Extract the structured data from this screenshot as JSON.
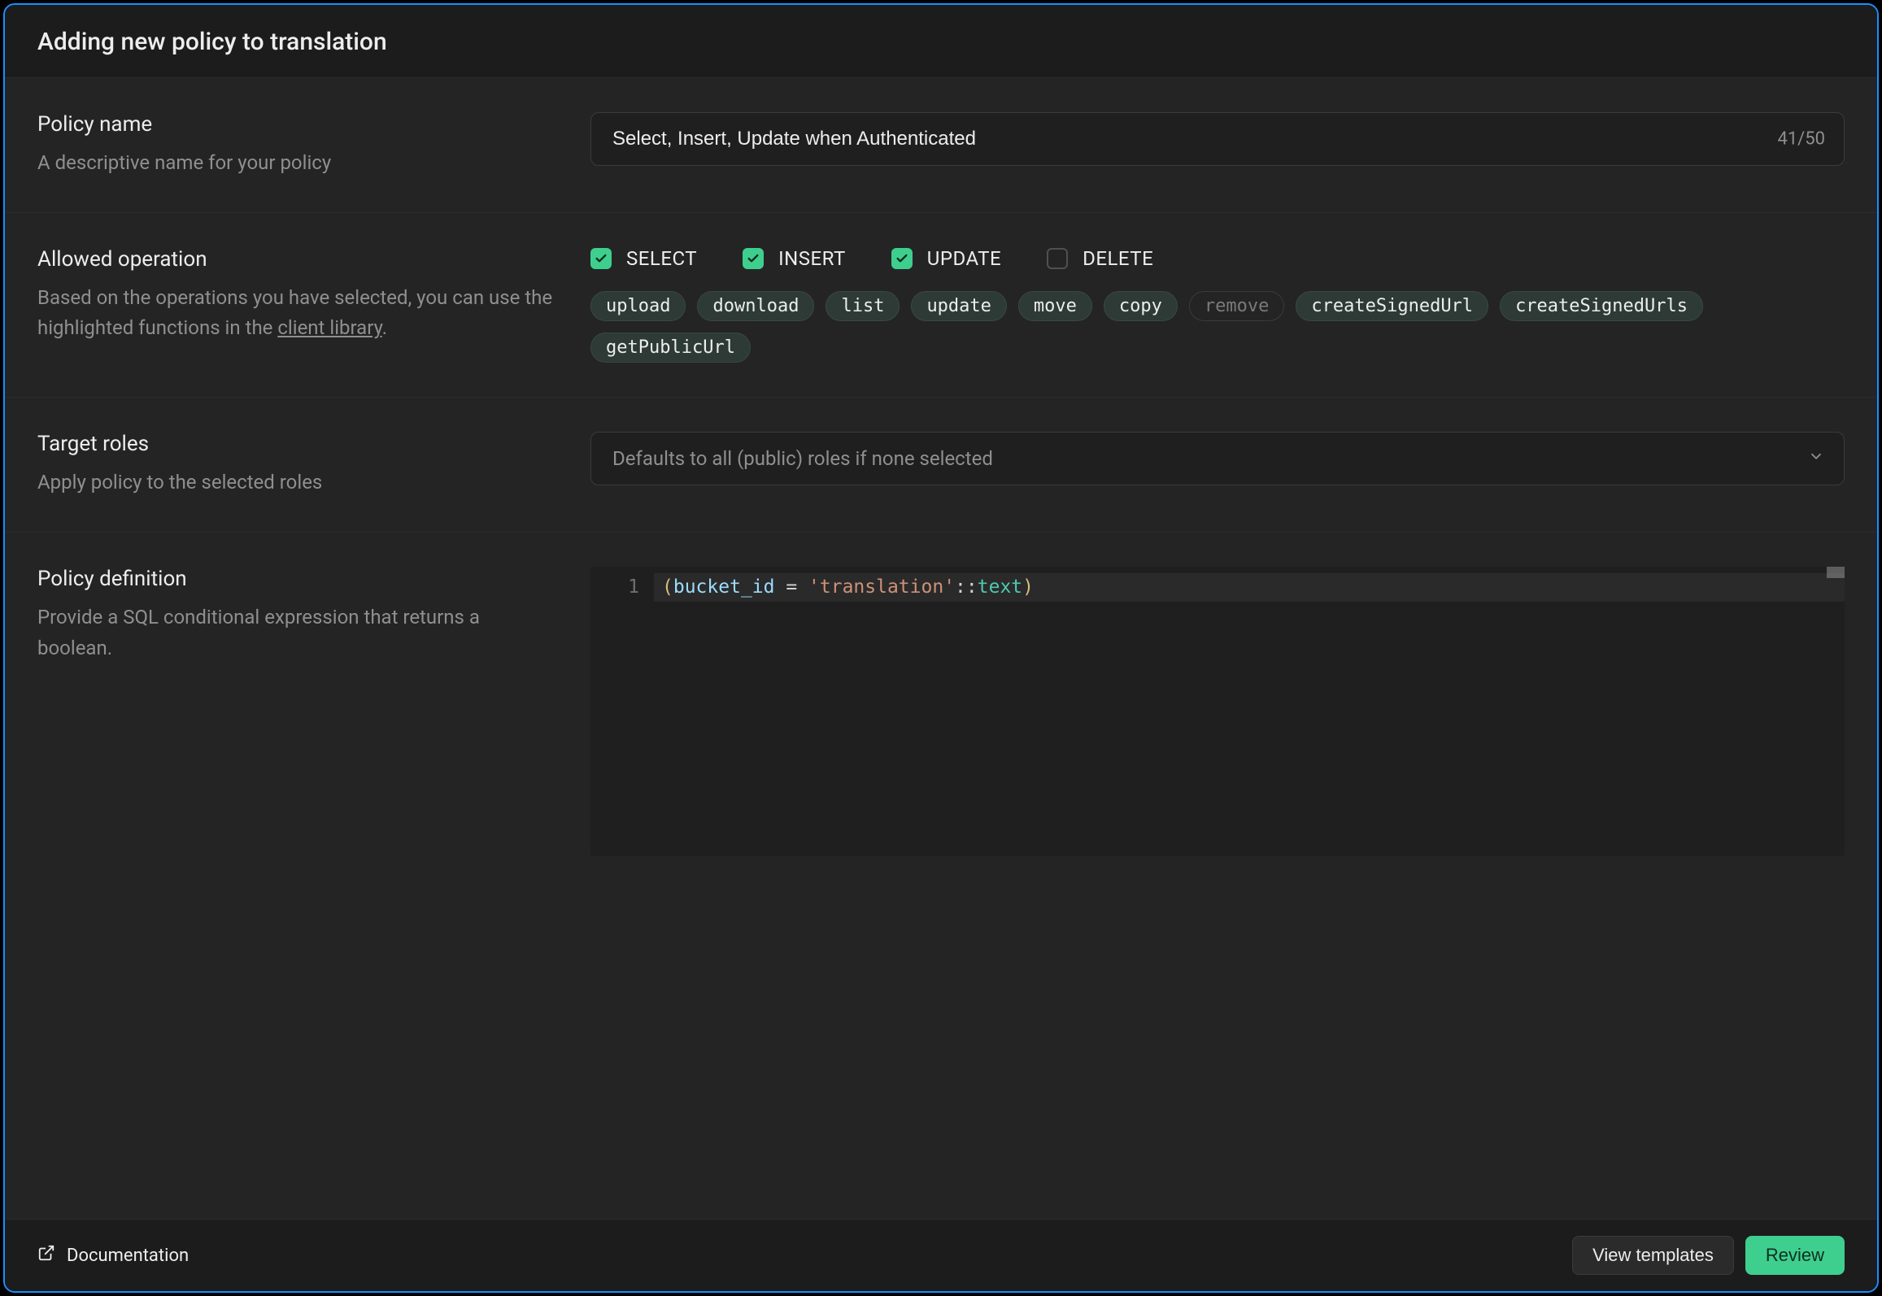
{
  "header": {
    "title": "Adding new policy to translation"
  },
  "policy_name": {
    "title": "Policy name",
    "desc": "A descriptive name for your policy",
    "value": "Select, Insert, Update when Authenticated",
    "count": "41/50"
  },
  "allowed_operation": {
    "title": "Allowed operation",
    "desc_pre": "Based on the operations you have selected, you can use the highlighted functions in the ",
    "desc_link": "client library",
    "desc_post": ".",
    "options": [
      {
        "label": "SELECT",
        "checked": true
      },
      {
        "label": "INSERT",
        "checked": true
      },
      {
        "label": "UPDATE",
        "checked": true
      },
      {
        "label": "DELETE",
        "checked": false
      }
    ],
    "tags": [
      {
        "label": "upload",
        "highlighted": true
      },
      {
        "label": "download",
        "highlighted": true
      },
      {
        "label": "list",
        "highlighted": true
      },
      {
        "label": "update",
        "highlighted": true
      },
      {
        "label": "move",
        "highlighted": true
      },
      {
        "label": "copy",
        "highlighted": true
      },
      {
        "label": "remove",
        "highlighted": false
      },
      {
        "label": "createSignedUrl",
        "highlighted": true
      },
      {
        "label": "createSignedUrls",
        "highlighted": true
      },
      {
        "label": "getPublicUrl",
        "highlighted": true
      }
    ]
  },
  "target_roles": {
    "title": "Target roles",
    "desc": "Apply policy to the selected roles",
    "placeholder": "Defaults to all (public) roles if none selected"
  },
  "policy_definition": {
    "title": "Policy definition",
    "desc": "Provide a SQL conditional expression that returns a boolean.",
    "line_number": "1",
    "code": {
      "open_paren": "(",
      "ident": "bucket_id",
      "eq": " = ",
      "str": "'translation'",
      "cast": "::",
      "type": "text",
      "close_paren": ")"
    }
  },
  "footer": {
    "documentation": "Documentation",
    "view_templates": "View templates",
    "review": "Review"
  }
}
